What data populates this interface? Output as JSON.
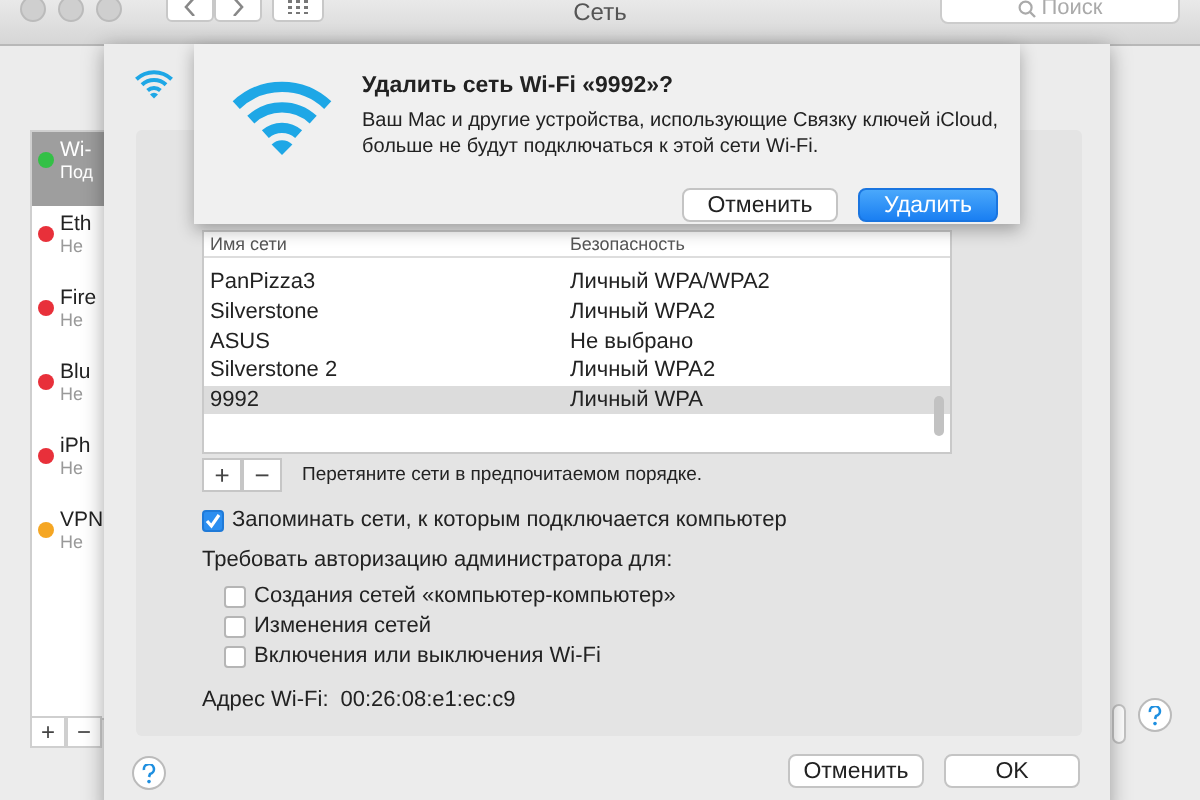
{
  "window": {
    "title": "Сеть",
    "search": {
      "placeholder": "Поиск"
    }
  },
  "sidebar": {
    "items": [
      {
        "name": "Wi-",
        "status": "Под",
        "color": "#33c046",
        "selected": true
      },
      {
        "name": "Eth",
        "status": "Не",
        "color": "#e8303a",
        "selected": false
      },
      {
        "name": "Fire",
        "status": "Не",
        "color": "#e8303a",
        "selected": false
      },
      {
        "name": "Blu",
        "status": "Не",
        "color": "#e8303a",
        "selected": false
      },
      {
        "name": "iPh",
        "status": "Не",
        "color": "#e8303a",
        "selected": false
      },
      {
        "name": "VPN",
        "status": "Не",
        "color": "#f5a623",
        "selected": false
      }
    ]
  },
  "advanced_sheet": {
    "table": {
      "columns": [
        "Имя сети",
        "Безопасность"
      ],
      "rows": [
        {
          "cells": [
            "PanPizza3",
            "Личный WPA/WPA2"
          ],
          "selected": false
        },
        {
          "cells": [
            "Silverstone",
            "Личный WPA2"
          ],
          "selected": false
        },
        {
          "cells": [
            "ASUS",
            "Не выбрано"
          ],
          "selected": false
        },
        {
          "cells": [
            "Silverstone 2",
            "Личный WPA2"
          ],
          "selected": false
        },
        {
          "cells": [
            "9992",
            "Личный WPA"
          ],
          "selected": true
        }
      ]
    },
    "list_buttons": [
      "+",
      "−"
    ],
    "drag_hint": "Перетяните сети в предпочитаемом порядке.",
    "remember": {
      "label": "Запоминать сети, к которым подключается компьютер",
      "checked": true
    },
    "require_label": "Требовать авторизацию администратора для:",
    "require_options": [
      {
        "label": "Создания сетей «компьютер-компьютер»",
        "checked": false
      },
      {
        "label": "Изменения сетей",
        "checked": false
      },
      {
        "label": "Включения или выключения Wi-Fi",
        "checked": false
      }
    ],
    "address": {
      "label": "Адрес Wi-Fi:",
      "value": "00:26:08:e1:ec:c9"
    },
    "buttons": [
      {
        "label": "Отменить",
        "default": false
      },
      {
        "label": "OK",
        "default": false
      }
    ]
  },
  "alert": {
    "title": "Удалить сеть Wi-Fi «9992»?",
    "message": "Ваш Mac и другие устройства, использующие Связку ключей iCloud, больше не будут подключаться к этой сети Wi-Fi.",
    "buttons": [
      {
        "label": "Отменить",
        "default": false
      },
      {
        "label": "Удалить",
        "default": true
      }
    ]
  },
  "sidebar_buttons": [
    "+",
    "−"
  ]
}
